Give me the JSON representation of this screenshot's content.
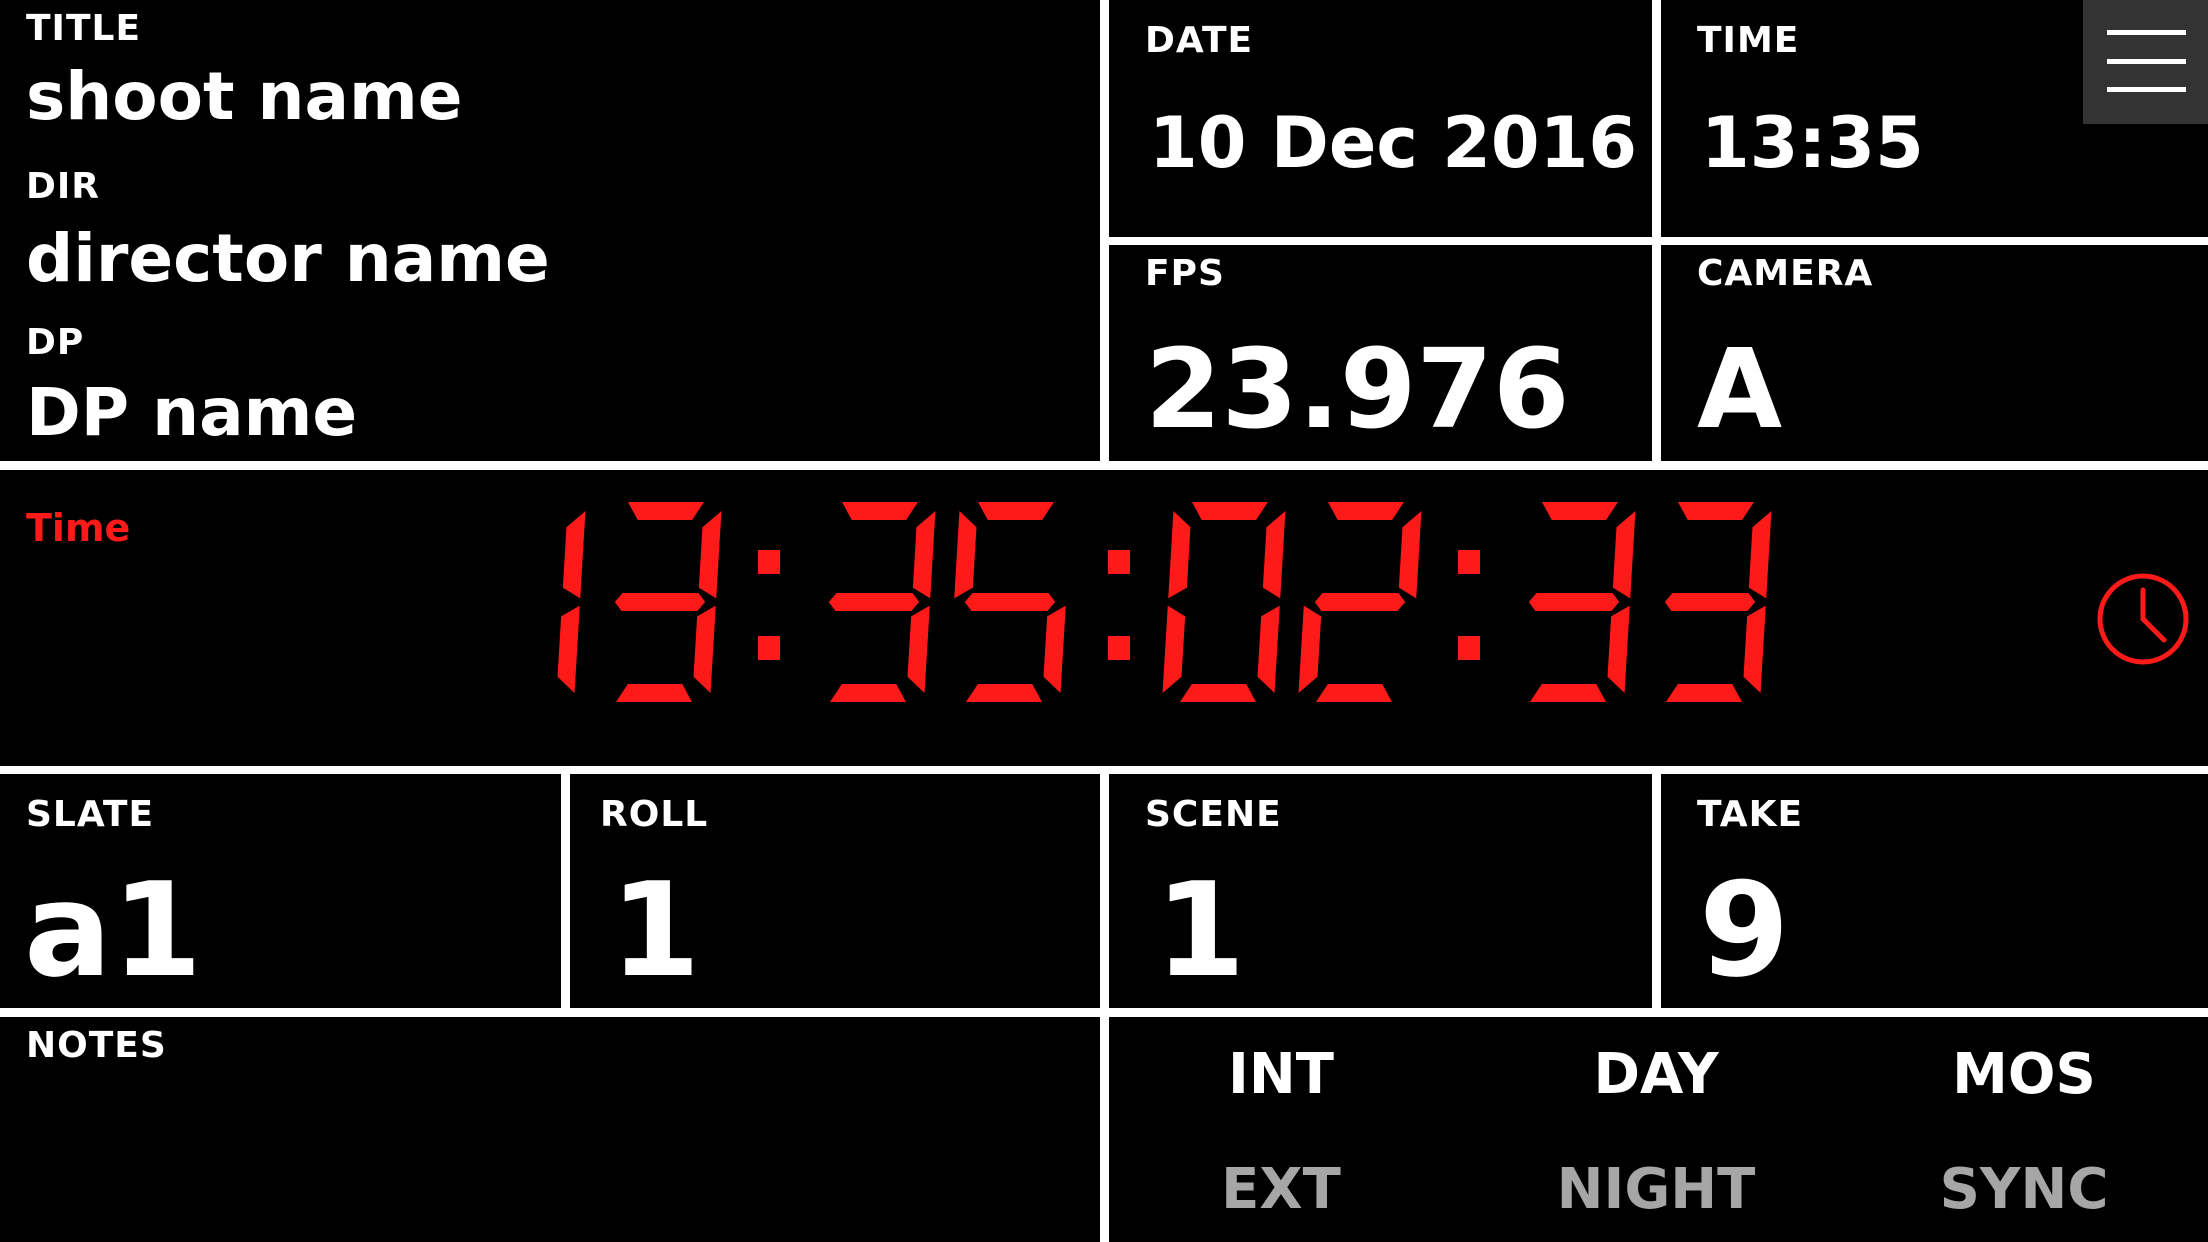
{
  "header": {
    "title_label": "TITLE",
    "title_value": "shoot name",
    "dir_label": "DIR",
    "dir_value": "director name",
    "dp_label": "DP",
    "dp_value": "DP name",
    "date_label": "DATE",
    "date_value": "10 Dec 2016",
    "time_label": "TIME",
    "time_value": "13:35",
    "fps_label": "FPS",
    "fps_value": "23.976",
    "camera_label": "CAMERA",
    "camera_value": "A"
  },
  "timecode": {
    "label": "Time",
    "value": "13:35:02:33",
    "color": "#ff1a1a"
  },
  "slate": {
    "slate_label": "SLATE",
    "slate_value": "a1",
    "roll_label": "ROLL",
    "roll_value": "1",
    "scene_label": "SCENE",
    "scene_value": "1",
    "take_label": "TAKE",
    "take_value": "9"
  },
  "notes": {
    "label": "NOTES"
  },
  "toggles": {
    "int": "INT",
    "ext": "EXT",
    "day": "DAY",
    "night": "NIGHT",
    "mos": "MOS",
    "sync": "SYNC"
  },
  "icons": {
    "menu": "hamburger-menu-icon",
    "clock": "clock-icon"
  }
}
